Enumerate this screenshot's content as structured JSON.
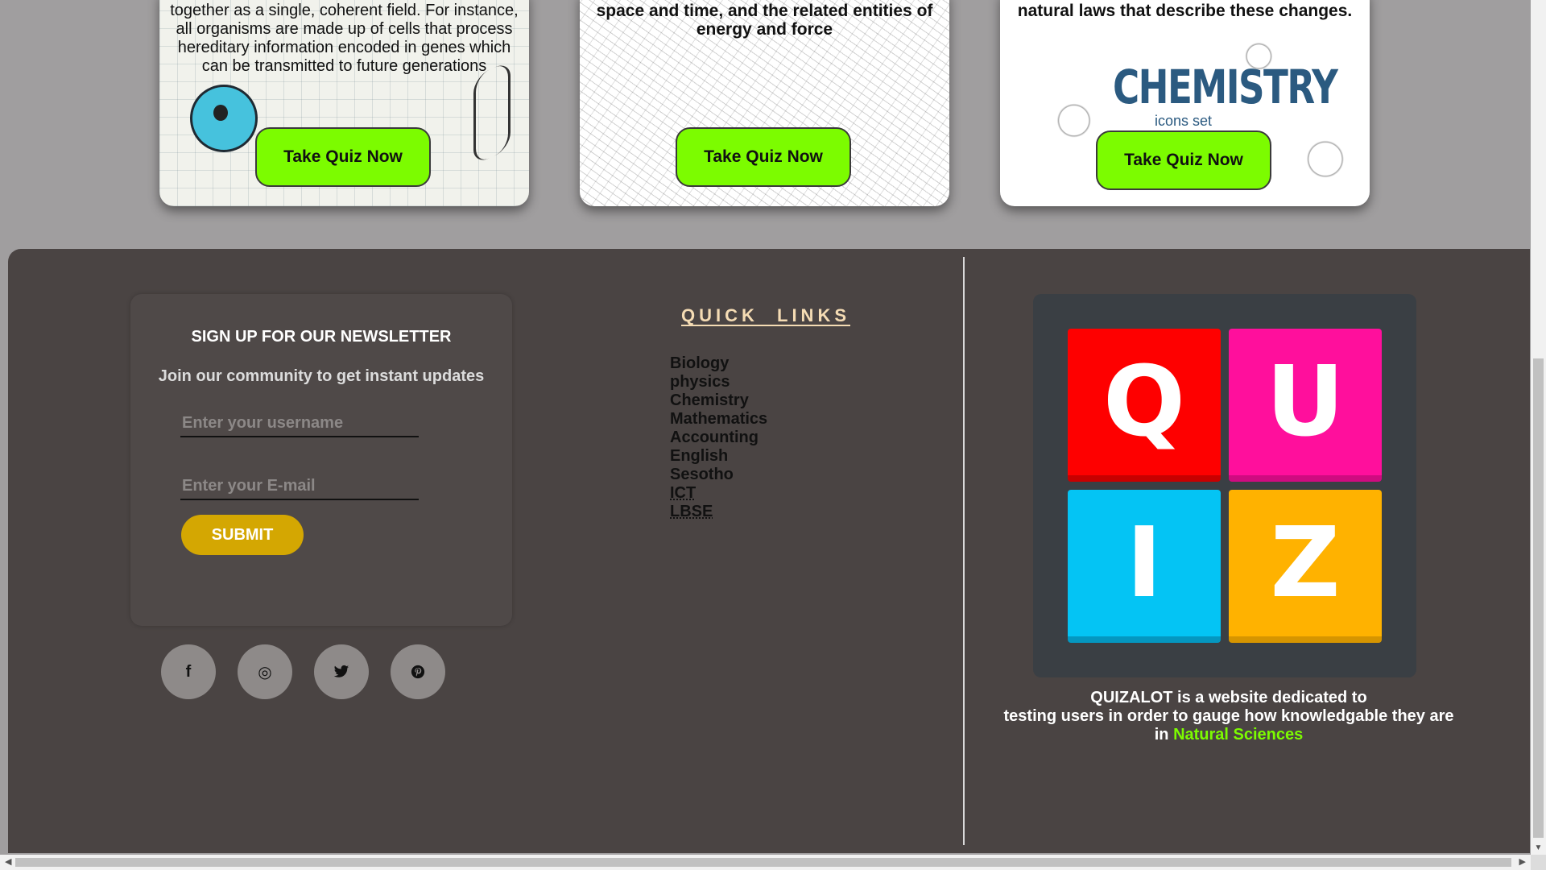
{
  "cards": [
    {
      "subject": "biology",
      "text": "together as a single, coherent field. For instance, all organisms are made up of cells that process hereditary information encoded in genes which can be transmitted to future generations",
      "button": "Take Quiz Now"
    },
    {
      "subject": "physics",
      "text": "space and time, and the related entities of energy and force",
      "button": "Take Quiz Now"
    },
    {
      "subject": "chemistry",
      "text": "natural laws that describe these changes.",
      "image_title": "CHEMISTRY",
      "image_subtitle": "icons set",
      "button": "Take Quiz Now"
    }
  ],
  "newsletter": {
    "title": "SIGN UP FOR OUR NEWSLETTER",
    "subtitle": "Join our community to get instant updates",
    "username_placeholder": "Enter your username",
    "email_placeholder": "Enter your E-mail",
    "submit_label": "SUBMIT"
  },
  "social": [
    {
      "name": "facebook-icon",
      "glyph": "f"
    },
    {
      "name": "instagram-icon",
      "glyph": "◎"
    },
    {
      "name": "twitter-icon",
      "glyph": "🐦"
    },
    {
      "name": "pinterest-icon",
      "glyph": "℗"
    }
  ],
  "quick_links": {
    "title": "QUICK LINKS",
    "items": [
      "Biology",
      "physics",
      "Chemistry",
      "Mathematics",
      "Accounting",
      "English",
      "Sesotho",
      "ICT",
      "LBSE"
    ]
  },
  "logo": {
    "letters": [
      "Q",
      "U",
      "I",
      "Z"
    ],
    "colors": [
      "#fe0000",
      "#ff0f9c",
      "#04c4f4",
      "#ffb200"
    ]
  },
  "about": {
    "line1": "QUIZALOT is a website dedicated to",
    "line2": "testing users in order to gauge how knowledgable they are",
    "line3_prefix": "in",
    "line3_accent": "Natural Sciences"
  },
  "colors": {
    "page_bg": "#a09e9f",
    "footer_bg": "#4a4443",
    "button_green": "#7cfc00",
    "submit_gold": "#d4a702",
    "accent_green": "#7cfc00"
  }
}
